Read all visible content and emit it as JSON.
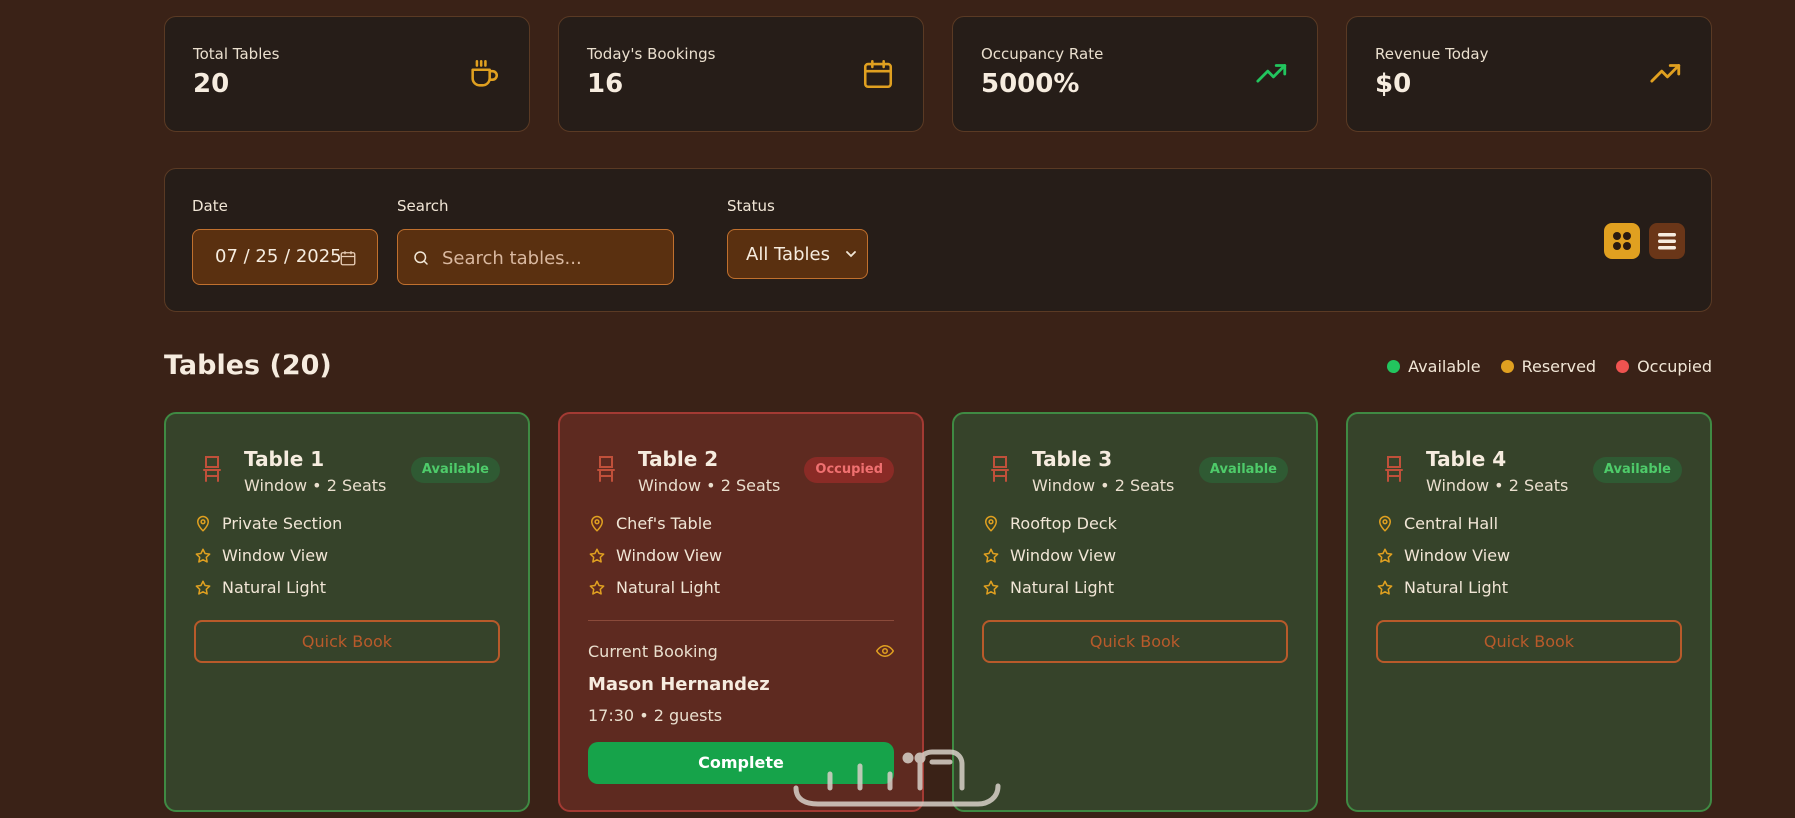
{
  "stats": [
    {
      "label": "Total Tables",
      "value": "20",
      "icon": "coffee-cup-icon"
    },
    {
      "label": "Today's Bookings",
      "value": "16",
      "icon": "calendar-icon"
    },
    {
      "label": "Occupancy Rate",
      "value": "5000%",
      "icon": "trending-up-icon"
    },
    {
      "label": "Revenue Today",
      "value": "$0",
      "icon": "trending-up-icon"
    }
  ],
  "filters": {
    "date_label": "Date",
    "date_value": "07 / 25 / 2025",
    "search_label": "Search",
    "search_placeholder": "Search tables...",
    "status_label": "Status",
    "status_value": "All Tables"
  },
  "tables_section": {
    "title": "Tables (20)",
    "legend": [
      {
        "label": "Available",
        "color": "#22c55e"
      },
      {
        "label": "Reserved",
        "color": "#e0a020"
      },
      {
        "label": "Occupied",
        "color": "#ef5350"
      }
    ]
  },
  "tables": [
    {
      "name": "Table 1",
      "sub": "Window • 2 Seats",
      "status": "Available",
      "location": "Private Section",
      "features": [
        "Window View",
        "Natural Light"
      ],
      "action": "Quick Book"
    },
    {
      "name": "Table 2",
      "sub": "Window • 2 Seats",
      "status": "Occupied",
      "location": "Chef's Table",
      "features": [
        "Window View",
        "Natural Light"
      ],
      "booking": {
        "label": "Current Booking",
        "guest": "Mason Hernandez",
        "details": "17:30 • 2 guests",
        "action": "Complete"
      }
    },
    {
      "name": "Table 3",
      "sub": "Window • 2 Seats",
      "status": "Available",
      "location": "Rooftop Deck",
      "features": [
        "Window View",
        "Natural Light"
      ],
      "action": "Quick Book"
    },
    {
      "name": "Table 4",
      "sub": "Window • 2 Seats",
      "status": "Available",
      "location": "Central Hall",
      "features": [
        "Window View",
        "Natural Light"
      ],
      "action": "Quick Book"
    }
  ],
  "colors": {
    "accent": "#e0a020",
    "available": "#22c55e",
    "occupied": "#ef5350",
    "complete": "#16a34a"
  }
}
